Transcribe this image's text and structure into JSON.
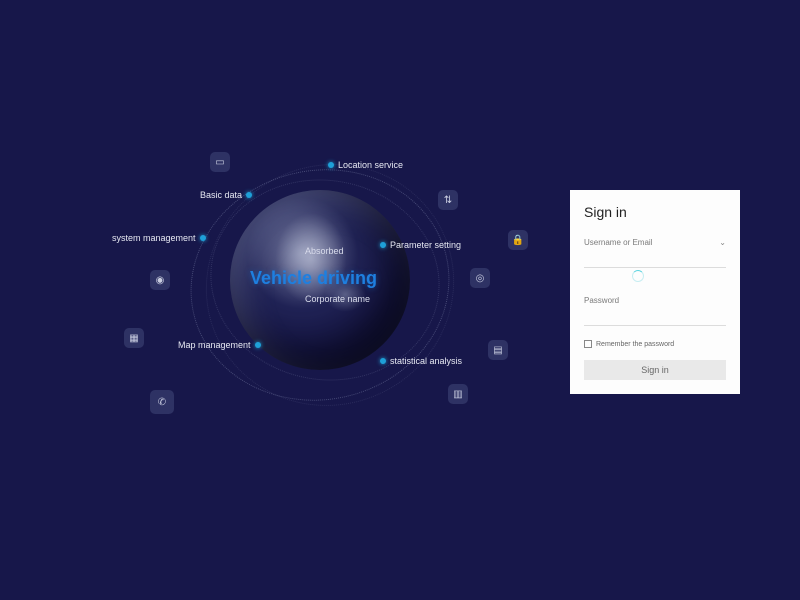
{
  "hero": {
    "title": "Vehicle driving",
    "subtitle_top": "Absorbed",
    "subtitle_bottom": "Corporate name",
    "labels": {
      "location_service": "Location service",
      "basic_data": "Basic data",
      "system_management": "system management",
      "parameter_setting": "Parameter setting",
      "map_management": "Map management",
      "statistical_analysis": "statistical analysis"
    }
  },
  "login": {
    "title": "Sign in",
    "username_label": "Username or Email",
    "username_value": "",
    "password_label": "Password",
    "password_value": "",
    "remember_label": "Remember the password",
    "submit_label": "Sign in"
  },
  "colors": {
    "background": "#17174a",
    "accent_blue": "#1e7fe0",
    "dot": "#1ea0d8"
  }
}
